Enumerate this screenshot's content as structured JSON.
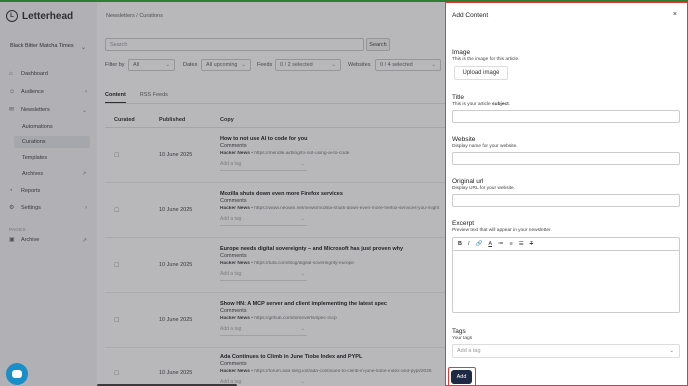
{
  "app": {
    "name": "Letterhead"
  },
  "workspace": {
    "name": "Black Bitter Matcha Times"
  },
  "sidebar": {
    "items": [
      {
        "label": "Dashboard",
        "icon": "home-icon"
      },
      {
        "label": "Audience",
        "icon": "users-icon"
      },
      {
        "label": "Newsletters",
        "icon": "newsletter-icon"
      },
      {
        "label": "Reports",
        "icon": "chart-icon"
      },
      {
        "label": "Settings",
        "icon": "gear-icon"
      }
    ],
    "sub_items": [
      "Automations",
      "Curations",
      "Templates",
      "Archives"
    ],
    "pages_label": "PAGES",
    "page_items": [
      {
        "label": "Archive",
        "icon": "archive-icon"
      }
    ]
  },
  "main": {
    "breadcrumb": "Newsletters / Curations",
    "search_placeholder": "Search",
    "search_button": "Search",
    "filters": {
      "filter_by_label": "Filter by",
      "filter_by_value": "All",
      "dates_label": "Dates",
      "dates_value": "All upcoming",
      "feeds_label": "Feeds",
      "feeds_value": "0 / 2 selected",
      "websites_label": "Websites",
      "websites_value": "0 / 4 selected"
    },
    "tabs": [
      "Content",
      "RSS Feeds"
    ],
    "columns": [
      "Curated",
      "Published",
      "Copy"
    ],
    "rows": [
      {
        "date": "10 June 2025",
        "title": "How to not use AI to code for you",
        "comments": "Comments",
        "source": "Hacker News",
        "url": "https://mendle.ai/blog/to-not-using-ai-to-code",
        "tag_placeholder": "Add a tag"
      },
      {
        "date": "10 June 2025",
        "title": "Mozilla shuts down even more Firefox services",
        "comments": "Comments",
        "source": "Hacker News",
        "url": "https://www.neowin.net/news/mozilla-shuts-down-even-more-firefox-services-you-might",
        "tag_placeholder": "Add a tag"
      },
      {
        "date": "10 June 2025",
        "title": "Europe needs digital sovereignty – and Microsoft has just proven why",
        "comments": "Comments",
        "source": "Hacker News",
        "url": "https://tuta.com/blog/digital-sovereignty-europe",
        "tag_placeholder": "Add a tag"
      },
      {
        "date": "10 June 2025",
        "title": "Show HN: A MCP server and client implementing the latest spec",
        "comments": "Comments",
        "source": "Hacker News",
        "url": "https://github.com/tomeverts/spec-mcp",
        "tag_placeholder": "Add a tag"
      },
      {
        "date": "10 June 2025",
        "title": "Ada Continues to Climb in June Tiobe Index and PYPL",
        "comments": "Comments",
        "source": "Hacker News",
        "url": "https://forum.ada-lang.io/t/ada-continues-to-climb-in-june-tiobe-index-and-pypl/2026",
        "tag_placeholder": "Add a tag"
      }
    ]
  },
  "panel": {
    "title": "Add Content",
    "close": "×",
    "image_label": "Image",
    "image_help": "This is the image for this article.",
    "upload_button": "Upload image",
    "title_label": "Title",
    "title_help_prefix": "This is your article ",
    "title_help_bold": "subject",
    "title_help_suffix": ".",
    "website_label": "Website",
    "website_help": "Display name for your website.",
    "original_url_label": "Original url",
    "original_url_help": "Display URL for your website.",
    "excerpt_label": "Excerpt",
    "excerpt_help": "Preview text that will appear in your newsletter.",
    "toolbar": [
      "B",
      "I",
      "🔗",
      "A",
      "≔",
      "≡",
      "☰",
      "T"
    ],
    "tags_label": "Tags",
    "tags_help": "Your tags",
    "tags_placeholder": "Add a tag",
    "add_button": "Add"
  },
  "colors": {
    "highlight": "#e53935",
    "primary_button": "#1e2a44",
    "chat": "#1a8fc7"
  }
}
